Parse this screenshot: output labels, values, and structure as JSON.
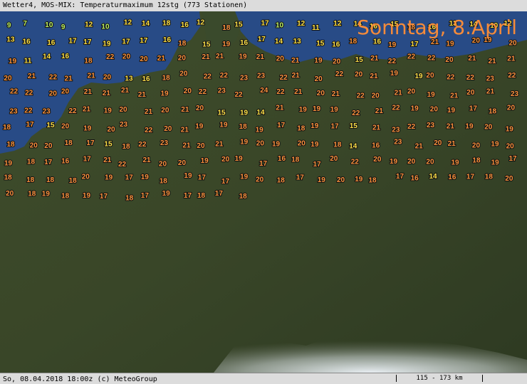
{
  "window": {
    "title": "Wetter4, MOS-MIX: Temperaturmaximum 12stg (773 Stationen)"
  },
  "map": {
    "headline": "Sonntag, 8.April",
    "colors": {
      "water": "#2a4a87",
      "land": "#3c4a2a",
      "cold": "#bef264",
      "cool": "#fde047",
      "warm": "#fb923c"
    },
    "temperature_labels": [
      {
        "v": "9",
        "c": "cold"
      },
      {
        "v": "7",
        "c": "cold"
      },
      {
        "v": "10",
        "c": "cold"
      },
      {
        "v": "9",
        "c": "cold"
      },
      {
        "v": "12",
        "c": "cool"
      },
      {
        "v": "10",
        "c": "cold"
      },
      {
        "v": "12",
        "c": "cool"
      },
      {
        "v": "14",
        "c": "cool"
      },
      {
        "v": "18",
        "c": "cool"
      },
      {
        "v": "16",
        "c": "cool"
      },
      {
        "v": "12",
        "c": "cool"
      },
      {
        "v": "18",
        "c": "warm"
      },
      {
        "v": "15",
        "c": "cool"
      },
      {
        "v": "17",
        "c": "cool"
      },
      {
        "v": "10",
        "c": "cold"
      },
      {
        "v": "12",
        "c": "cool"
      },
      {
        "v": "11",
        "c": "cool"
      },
      {
        "v": "12",
        "c": "cool"
      },
      {
        "v": "14",
        "c": "cool"
      },
      {
        "v": "16",
        "c": "cool"
      },
      {
        "v": "15",
        "c": "cool"
      },
      {
        "v": "18",
        "c": "warm"
      },
      {
        "v": "16",
        "c": "cool"
      },
      {
        "v": "13",
        "c": "cool"
      },
      {
        "v": "14",
        "c": "cool"
      },
      {
        "v": "10",
        "c": "cool"
      },
      {
        "v": "12",
        "c": "cool"
      },
      {
        "v": "13",
        "c": "cool"
      },
      {
        "v": "16",
        "c": "cool"
      },
      {
        "v": "16",
        "c": "cool"
      },
      {
        "v": "17",
        "c": "cool"
      },
      {
        "v": "17",
        "c": "cool"
      },
      {
        "v": "19",
        "c": "cool"
      },
      {
        "v": "17",
        "c": "cool"
      },
      {
        "v": "17",
        "c": "cool"
      },
      {
        "v": "16",
        "c": "cool"
      },
      {
        "v": "18",
        "c": "warm"
      },
      {
        "v": "15",
        "c": "cool"
      },
      {
        "v": "19",
        "c": "warm"
      },
      {
        "v": "16",
        "c": "cool"
      },
      {
        "v": "17",
        "c": "cool"
      },
      {
        "v": "14",
        "c": "cool"
      },
      {
        "v": "13",
        "c": "cool"
      },
      {
        "v": "15",
        "c": "cool"
      },
      {
        "v": "16",
        "c": "cool"
      },
      {
        "v": "18",
        "c": "warm"
      },
      {
        "v": "16",
        "c": "cool"
      },
      {
        "v": "19",
        "c": "warm"
      },
      {
        "v": "17",
        "c": "cool"
      },
      {
        "v": "21",
        "c": "warm"
      },
      {
        "v": "19",
        "c": "warm"
      },
      {
        "v": "20",
        "c": "warm"
      },
      {
        "v": "19",
        "c": "warm"
      },
      {
        "v": "20",
        "c": "warm"
      },
      {
        "v": "19",
        "c": "warm"
      },
      {
        "v": "11",
        "c": "cool"
      },
      {
        "v": "14",
        "c": "cool"
      },
      {
        "v": "16",
        "c": "cool"
      },
      {
        "v": "18",
        "c": "warm"
      },
      {
        "v": "22",
        "c": "warm"
      },
      {
        "v": "20",
        "c": "warm"
      },
      {
        "v": "20",
        "c": "warm"
      },
      {
        "v": "21",
        "c": "warm"
      },
      {
        "v": "20",
        "c": "warm"
      },
      {
        "v": "21",
        "c": "warm"
      },
      {
        "v": "21",
        "c": "warm"
      },
      {
        "v": "19",
        "c": "warm"
      },
      {
        "v": "21",
        "c": "warm"
      },
      {
        "v": "20",
        "c": "warm"
      },
      {
        "v": "21",
        "c": "warm"
      },
      {
        "v": "19",
        "c": "warm"
      },
      {
        "v": "20",
        "c": "warm"
      },
      {
        "v": "15",
        "c": "cool"
      },
      {
        "v": "21",
        "c": "warm"
      },
      {
        "v": "22",
        "c": "warm"
      },
      {
        "v": "22",
        "c": "warm"
      },
      {
        "v": "22",
        "c": "warm"
      },
      {
        "v": "20",
        "c": "warm"
      },
      {
        "v": "21",
        "c": "warm"
      },
      {
        "v": "21",
        "c": "warm"
      },
      {
        "v": "21",
        "c": "warm"
      },
      {
        "v": "20",
        "c": "warm"
      },
      {
        "v": "21",
        "c": "warm"
      },
      {
        "v": "22",
        "c": "warm"
      },
      {
        "v": "21",
        "c": "warm"
      },
      {
        "v": "21",
        "c": "warm"
      },
      {
        "v": "20",
        "c": "warm"
      },
      {
        "v": "13",
        "c": "cool"
      },
      {
        "v": "16",
        "c": "cool"
      },
      {
        "v": "18",
        "c": "warm"
      },
      {
        "v": "20",
        "c": "warm"
      },
      {
        "v": "22",
        "c": "warm"
      },
      {
        "v": "22",
        "c": "warm"
      },
      {
        "v": "23",
        "c": "warm"
      },
      {
        "v": "23",
        "c": "warm"
      },
      {
        "v": "22",
        "c": "warm"
      },
      {
        "v": "21",
        "c": "warm"
      },
      {
        "v": "20",
        "c": "warm"
      },
      {
        "v": "22",
        "c": "warm"
      },
      {
        "v": "20",
        "c": "warm"
      },
      {
        "v": "21",
        "c": "warm"
      },
      {
        "v": "19",
        "c": "warm"
      },
      {
        "v": "19",
        "c": "cool"
      },
      {
        "v": "20",
        "c": "warm"
      },
      {
        "v": "22",
        "c": "warm"
      },
      {
        "v": "22",
        "c": "warm"
      },
      {
        "v": "23",
        "c": "warm"
      },
      {
        "v": "22",
        "c": "warm"
      },
      {
        "v": "22",
        "c": "warm"
      },
      {
        "v": "22",
        "c": "warm"
      },
      {
        "v": "20",
        "c": "warm"
      },
      {
        "v": "20",
        "c": "warm"
      },
      {
        "v": "21",
        "c": "warm"
      },
      {
        "v": "21",
        "c": "warm"
      },
      {
        "v": "21",
        "c": "warm"
      },
      {
        "v": "21",
        "c": "warm"
      },
      {
        "v": "19",
        "c": "warm"
      },
      {
        "v": "20",
        "c": "warm"
      },
      {
        "v": "22",
        "c": "warm"
      },
      {
        "v": "23",
        "c": "warm"
      },
      {
        "v": "22",
        "c": "warm"
      },
      {
        "v": "24",
        "c": "warm"
      },
      {
        "v": "22",
        "c": "warm"
      },
      {
        "v": "21",
        "c": "warm"
      },
      {
        "v": "20",
        "c": "warm"
      },
      {
        "v": "21",
        "c": "warm"
      },
      {
        "v": "22",
        "c": "warm"
      },
      {
        "v": "20",
        "c": "warm"
      },
      {
        "v": "21",
        "c": "warm"
      },
      {
        "v": "20",
        "c": "warm"
      },
      {
        "v": "19",
        "c": "warm"
      },
      {
        "v": "21",
        "c": "warm"
      },
      {
        "v": "20",
        "c": "warm"
      },
      {
        "v": "21",
        "c": "warm"
      },
      {
        "v": "23",
        "c": "warm"
      },
      {
        "v": "23",
        "c": "warm"
      },
      {
        "v": "22",
        "c": "warm"
      },
      {
        "v": "23",
        "c": "warm"
      },
      {
        "v": "22",
        "c": "warm"
      },
      {
        "v": "21",
        "c": "warm"
      },
      {
        "v": "19",
        "c": "warm"
      },
      {
        "v": "20",
        "c": "warm"
      },
      {
        "v": "21",
        "c": "warm"
      },
      {
        "v": "20",
        "c": "warm"
      },
      {
        "v": "21",
        "c": "warm"
      },
      {
        "v": "20",
        "c": "warm"
      },
      {
        "v": "15",
        "c": "cool"
      },
      {
        "v": "19",
        "c": "cool"
      },
      {
        "v": "14",
        "c": "cool"
      },
      {
        "v": "21",
        "c": "warm"
      },
      {
        "v": "19",
        "c": "warm"
      },
      {
        "v": "19",
        "c": "warm"
      },
      {
        "v": "19",
        "c": "warm"
      },
      {
        "v": "22",
        "c": "warm"
      },
      {
        "v": "21",
        "c": "warm"
      },
      {
        "v": "22",
        "c": "warm"
      },
      {
        "v": "19",
        "c": "warm"
      },
      {
        "v": "20",
        "c": "warm"
      },
      {
        "v": "19",
        "c": "warm"
      },
      {
        "v": "17",
        "c": "warm"
      },
      {
        "v": "18",
        "c": "warm"
      },
      {
        "v": "20",
        "c": "warm"
      },
      {
        "v": "18",
        "c": "warm"
      },
      {
        "v": "17",
        "c": "warm"
      },
      {
        "v": "15",
        "c": "cool"
      },
      {
        "v": "20",
        "c": "warm"
      },
      {
        "v": "19",
        "c": "warm"
      },
      {
        "v": "20",
        "c": "warm"
      },
      {
        "v": "23",
        "c": "warm"
      },
      {
        "v": "22",
        "c": "warm"
      },
      {
        "v": "20",
        "c": "warm"
      },
      {
        "v": "21",
        "c": "warm"
      },
      {
        "v": "19",
        "c": "warm"
      },
      {
        "v": "19",
        "c": "warm"
      },
      {
        "v": "18",
        "c": "warm"
      },
      {
        "v": "19",
        "c": "warm"
      },
      {
        "v": "17",
        "c": "warm"
      },
      {
        "v": "18",
        "c": "warm"
      },
      {
        "v": "19",
        "c": "warm"
      },
      {
        "v": "17",
        "c": "warm"
      },
      {
        "v": "15",
        "c": "cool"
      },
      {
        "v": "21",
        "c": "warm"
      },
      {
        "v": "23",
        "c": "warm"
      },
      {
        "v": "22",
        "c": "warm"
      },
      {
        "v": "23",
        "c": "warm"
      },
      {
        "v": "21",
        "c": "warm"
      },
      {
        "v": "19",
        "c": "warm"
      },
      {
        "v": "20",
        "c": "warm"
      },
      {
        "v": "19",
        "c": "warm"
      },
      {
        "v": "18",
        "c": "warm"
      },
      {
        "v": "20",
        "c": "warm"
      },
      {
        "v": "20",
        "c": "warm"
      },
      {
        "v": "18",
        "c": "warm"
      },
      {
        "v": "17",
        "c": "warm"
      },
      {
        "v": "15",
        "c": "cool"
      },
      {
        "v": "18",
        "c": "warm"
      },
      {
        "v": "22",
        "c": "warm"
      },
      {
        "v": "23",
        "c": "warm"
      },
      {
        "v": "21",
        "c": "warm"
      },
      {
        "v": "20",
        "c": "warm"
      },
      {
        "v": "21",
        "c": "warm"
      },
      {
        "v": "19",
        "c": "warm"
      },
      {
        "v": "20",
        "c": "warm"
      },
      {
        "v": "19",
        "c": "warm"
      },
      {
        "v": "20",
        "c": "warm"
      },
      {
        "v": "19",
        "c": "warm"
      },
      {
        "v": "18",
        "c": "warm"
      },
      {
        "v": "14",
        "c": "cool"
      },
      {
        "v": "16",
        "c": "warm"
      },
      {
        "v": "23",
        "c": "warm"
      },
      {
        "v": "21",
        "c": "warm"
      },
      {
        "v": "20",
        "c": "warm"
      },
      {
        "v": "21",
        "c": "warm"
      },
      {
        "v": "20",
        "c": "warm"
      },
      {
        "v": "19",
        "c": "warm"
      },
      {
        "v": "20",
        "c": "warm"
      },
      {
        "v": "19",
        "c": "warm"
      },
      {
        "v": "18",
        "c": "warm"
      },
      {
        "v": "17",
        "c": "warm"
      },
      {
        "v": "16",
        "c": "warm"
      },
      {
        "v": "17",
        "c": "warm"
      },
      {
        "v": "21",
        "c": "warm"
      },
      {
        "v": "22",
        "c": "warm"
      },
      {
        "v": "21",
        "c": "warm"
      },
      {
        "v": "20",
        "c": "warm"
      },
      {
        "v": "20",
        "c": "warm"
      },
      {
        "v": "19",
        "c": "warm"
      },
      {
        "v": "20",
        "c": "warm"
      },
      {
        "v": "19",
        "c": "warm"
      },
      {
        "v": "17",
        "c": "warm"
      },
      {
        "v": "16",
        "c": "warm"
      },
      {
        "v": "18",
        "c": "warm"
      },
      {
        "v": "17",
        "c": "warm"
      },
      {
        "v": "20",
        "c": "warm"
      },
      {
        "v": "22",
        "c": "warm"
      },
      {
        "v": "20",
        "c": "warm"
      },
      {
        "v": "19",
        "c": "warm"
      },
      {
        "v": "20",
        "c": "warm"
      },
      {
        "v": "20",
        "c": "warm"
      },
      {
        "v": "19",
        "c": "warm"
      },
      {
        "v": "18",
        "c": "warm"
      },
      {
        "v": "19",
        "c": "warm"
      },
      {
        "v": "17",
        "c": "warm"
      },
      {
        "v": "18",
        "c": "warm"
      },
      {
        "v": "18",
        "c": "warm"
      },
      {
        "v": "18",
        "c": "warm"
      },
      {
        "v": "18",
        "c": "warm"
      },
      {
        "v": "20",
        "c": "warm"
      },
      {
        "v": "19",
        "c": "warm"
      },
      {
        "v": "17",
        "c": "warm"
      },
      {
        "v": "19",
        "c": "warm"
      },
      {
        "v": "18",
        "c": "warm"
      },
      {
        "v": "19",
        "c": "warm"
      },
      {
        "v": "17",
        "c": "warm"
      },
      {
        "v": "17",
        "c": "warm"
      },
      {
        "v": "19",
        "c": "warm"
      },
      {
        "v": "20",
        "c": "warm"
      },
      {
        "v": "18",
        "c": "warm"
      },
      {
        "v": "17",
        "c": "warm"
      },
      {
        "v": "19",
        "c": "warm"
      },
      {
        "v": "20",
        "c": "warm"
      },
      {
        "v": "19",
        "c": "warm"
      },
      {
        "v": "18",
        "c": "warm"
      },
      {
        "v": "17",
        "c": "warm"
      },
      {
        "v": "16",
        "c": "warm"
      },
      {
        "v": "14",
        "c": "cool"
      },
      {
        "v": "16",
        "c": "warm"
      },
      {
        "v": "17",
        "c": "warm"
      },
      {
        "v": "18",
        "c": "warm"
      },
      {
        "v": "20",
        "c": "warm"
      },
      {
        "v": "20",
        "c": "warm"
      },
      {
        "v": "18",
        "c": "warm"
      },
      {
        "v": "19",
        "c": "warm"
      },
      {
        "v": "18",
        "c": "warm"
      },
      {
        "v": "19",
        "c": "warm"
      },
      {
        "v": "17",
        "c": "warm"
      },
      {
        "v": "18",
        "c": "warm"
      },
      {
        "v": "17",
        "c": "warm"
      },
      {
        "v": "19",
        "c": "warm"
      },
      {
        "v": "17",
        "c": "warm"
      },
      {
        "v": "18",
        "c": "warm"
      },
      {
        "v": "17",
        "c": "warm"
      },
      {
        "v": "18",
        "c": "warm"
      }
    ]
  },
  "status": {
    "text": "So, 08.04.2018 18:00z (c) MeteoGroup",
    "scale": "115 - 173 km"
  }
}
